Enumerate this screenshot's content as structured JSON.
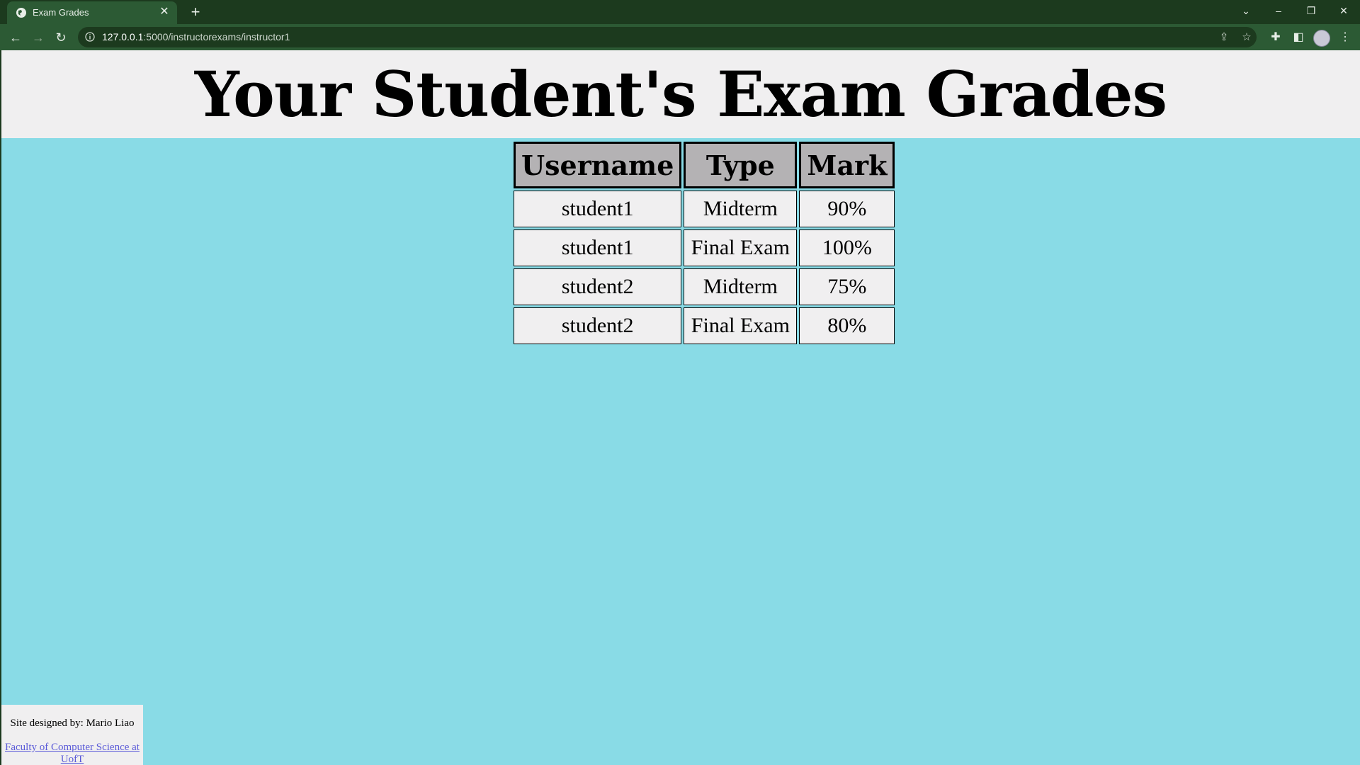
{
  "browser": {
    "tab_title": "Exam Grades",
    "url_host": "127.0.0.1",
    "url_rest": ":5000/instructorexams/instructor1",
    "new_tab": "+",
    "close": "✕"
  },
  "page": {
    "title": "Your Student's Exam Grades",
    "table": {
      "headers": [
        "Username",
        "Type",
        "Mark"
      ],
      "rows": [
        [
          "student1",
          "Midterm",
          "90%"
        ],
        [
          "student1",
          "Final Exam",
          "100%"
        ],
        [
          "student2",
          "Midterm",
          "75%"
        ],
        [
          "student2",
          "Final Exam",
          "80%"
        ]
      ]
    },
    "footer": {
      "designer": "Site designed by: Mario Liao",
      "link": "Faculty of Computer Science at UofT"
    }
  },
  "colors": {
    "page_bg": "#89dbe6",
    "header_bg": "#f0eff0",
    "th_bg": "#b4b2b4",
    "chrome": "#1c3a1e"
  }
}
